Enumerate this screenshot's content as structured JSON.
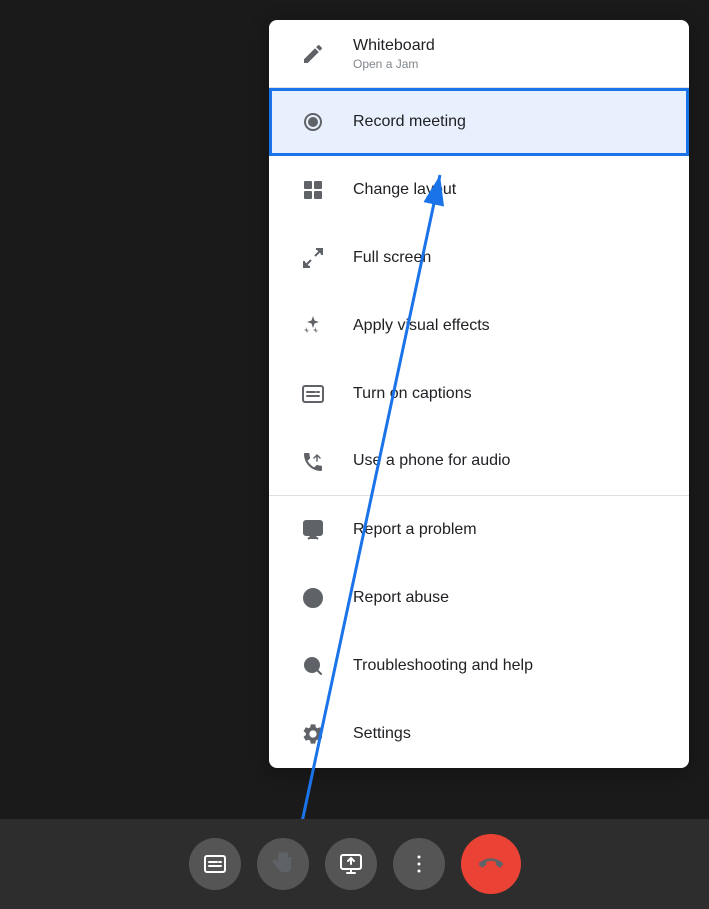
{
  "background": {
    "color": "#1a1a1a"
  },
  "menu": {
    "items": [
      {
        "id": "whiteboard",
        "label": "Whiteboard",
        "sublabel": "Open a Jam",
        "icon": "pencil-icon",
        "active": false,
        "divider_below": true
      },
      {
        "id": "record-meeting",
        "label": "Record meeting",
        "sublabel": "",
        "icon": "record-icon",
        "active": true,
        "divider_below": false
      },
      {
        "id": "change-layout",
        "label": "Change layout",
        "sublabel": "",
        "icon": "layout-icon",
        "active": false,
        "divider_below": false
      },
      {
        "id": "full-screen",
        "label": "Full screen",
        "sublabel": "",
        "icon": "fullscreen-icon",
        "active": false,
        "divider_below": false
      },
      {
        "id": "visual-effects",
        "label": "Apply visual effects",
        "sublabel": "",
        "icon": "sparkle-icon",
        "active": false,
        "divider_below": false
      },
      {
        "id": "captions",
        "label": "Turn on captions",
        "sublabel": "",
        "icon": "captions-icon",
        "active": false,
        "divider_below": false
      },
      {
        "id": "phone-audio",
        "label": "Use a phone for audio",
        "sublabel": "",
        "icon": "phone-icon",
        "active": false,
        "divider_below": true
      },
      {
        "id": "report-problem",
        "label": "Report a problem",
        "sublabel": "",
        "icon": "report-problem-icon",
        "active": false,
        "divider_below": false
      },
      {
        "id": "report-abuse",
        "label": "Report abuse",
        "sublabel": "",
        "icon": "report-abuse-icon",
        "active": false,
        "divider_below": false
      },
      {
        "id": "troubleshooting",
        "label": "Troubleshooting and help",
        "sublabel": "",
        "icon": "troubleshoot-icon",
        "active": false,
        "divider_below": false
      },
      {
        "id": "settings",
        "label": "Settings",
        "sublabel": "",
        "icon": "settings-icon",
        "active": false,
        "divider_below": false
      }
    ]
  },
  "toolbar": {
    "buttons": [
      {
        "id": "captions",
        "icon": "cc-icon",
        "label": "Captions"
      },
      {
        "id": "raise-hand",
        "icon": "hand-icon",
        "label": "Raise hand"
      },
      {
        "id": "present",
        "icon": "present-icon",
        "label": "Present"
      },
      {
        "id": "more",
        "icon": "more-icon",
        "label": "More options"
      },
      {
        "id": "end-call",
        "icon": "end-call-icon",
        "label": "End call"
      }
    ]
  }
}
